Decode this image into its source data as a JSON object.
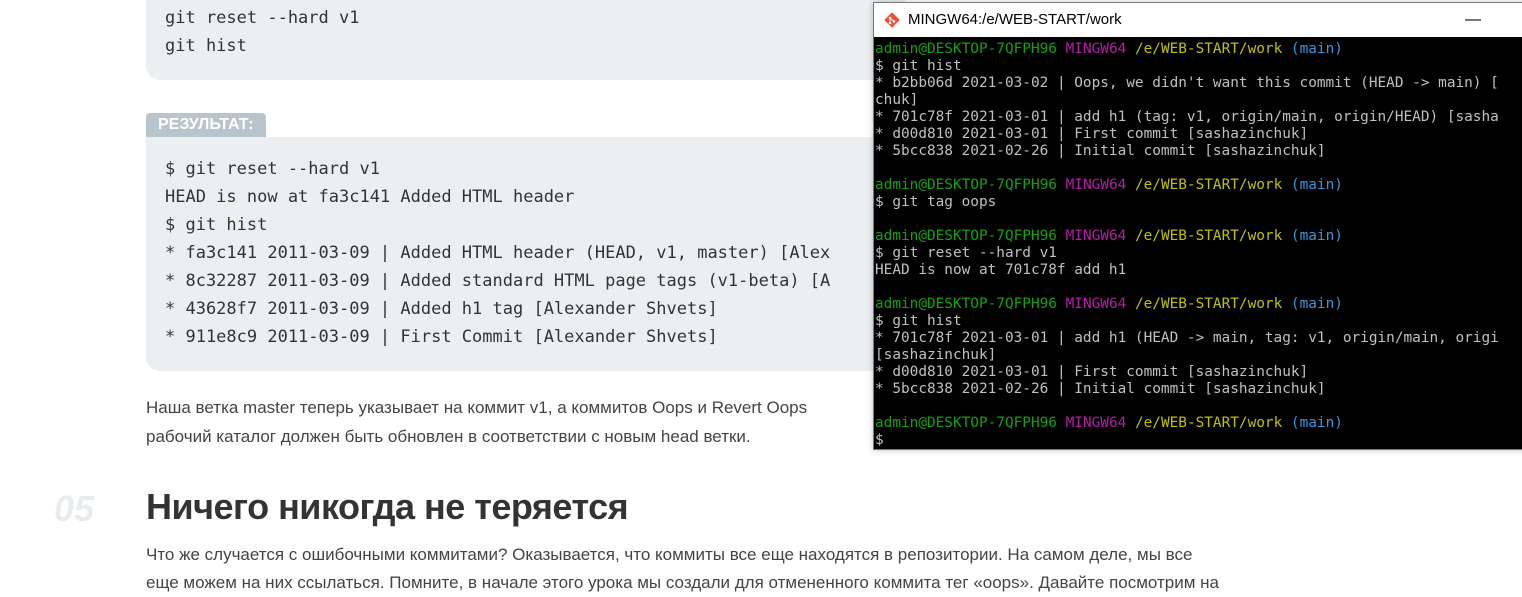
{
  "code_top": {
    "lines": [
      "git reset --hard v1",
      "git hist"
    ]
  },
  "result_label": "РЕЗУЛЬТАТ:",
  "code_result": {
    "lines": [
      "$ git reset --hard v1",
      "HEAD is now at fa3c141 Added HTML header",
      "$ git hist",
      "* fa3c141 2011-03-09 | Added HTML header (HEAD, v1, master) [Alex",
      "* 8c32287 2011-03-09 | Added standard HTML page tags (v1-beta) [A",
      "* 43628f7 2011-03-09 | Added h1 tag [Alexander Shvets]",
      "* 911e8c9 2011-03-09 | First Commit [Alexander Shvets]"
    ]
  },
  "paragraph": {
    "line1": "Наша ветка master теперь указывает на коммит v1, а коммитов Oops и Revert Oops",
    "line2": "рабочий каталог должен быть обновлен в соответствии с новым head ветки."
  },
  "section": {
    "number": "05",
    "title": "Ничего никогда не теряется"
  },
  "paragraph2": {
    "line1": "Что же случается с ошибочными коммитами? Оказывается, что коммиты все еще находятся в репозитории. На самом деле, мы все",
    "line2": "еще можем на них ссылаться. Помните, в начале этого урока мы создали для отмененного коммита тег «oops». Давайте посмотрим на"
  },
  "terminal": {
    "title": "MINGW64:/e/WEB-START/work",
    "minimize_glyph": "—",
    "prompt": {
      "user": "admin@DESKTOP-7QFPH96",
      "env": "MINGW64",
      "path": "/e/WEB-START/work",
      "branch": "(main)"
    },
    "block1": [
      "$ git hist",
      "* b2bb06d 2021-03-02 | Oops, we didn't want this commit (HEAD -> main) [",
      "chuk]",
      "* 701c78f 2021-03-01 | add h1 (tag: v1, origin/main, origin/HEAD) [sasha",
      "* d00d810 2021-03-01 | First commit [sashazinchuk]",
      "* 5bcc838 2021-02-26 | Initial commit [sashazinchuk]"
    ],
    "block2": [
      "$ git tag oops"
    ],
    "block3": [
      "$ git reset --hard v1",
      "HEAD is now at 701c78f add h1"
    ],
    "block4": [
      "$ git hist",
      "* 701c78f 2021-03-01 | add h1 (HEAD -> main, tag: v1, origin/main, origi",
      "[sashazinchuk]",
      "* d00d810 2021-03-01 | First commit [sashazinchuk]",
      "* 5bcc838 2021-02-26 | Initial commit [sashazinchuk]"
    ],
    "last_prompt_symbol": "$",
    "colors": {
      "user": "#13a10e",
      "env": "#b41ea8",
      "path": "#c1c100",
      "branch": "#3a96dd",
      "text": "#c0c0c0",
      "background": "#000000"
    }
  }
}
